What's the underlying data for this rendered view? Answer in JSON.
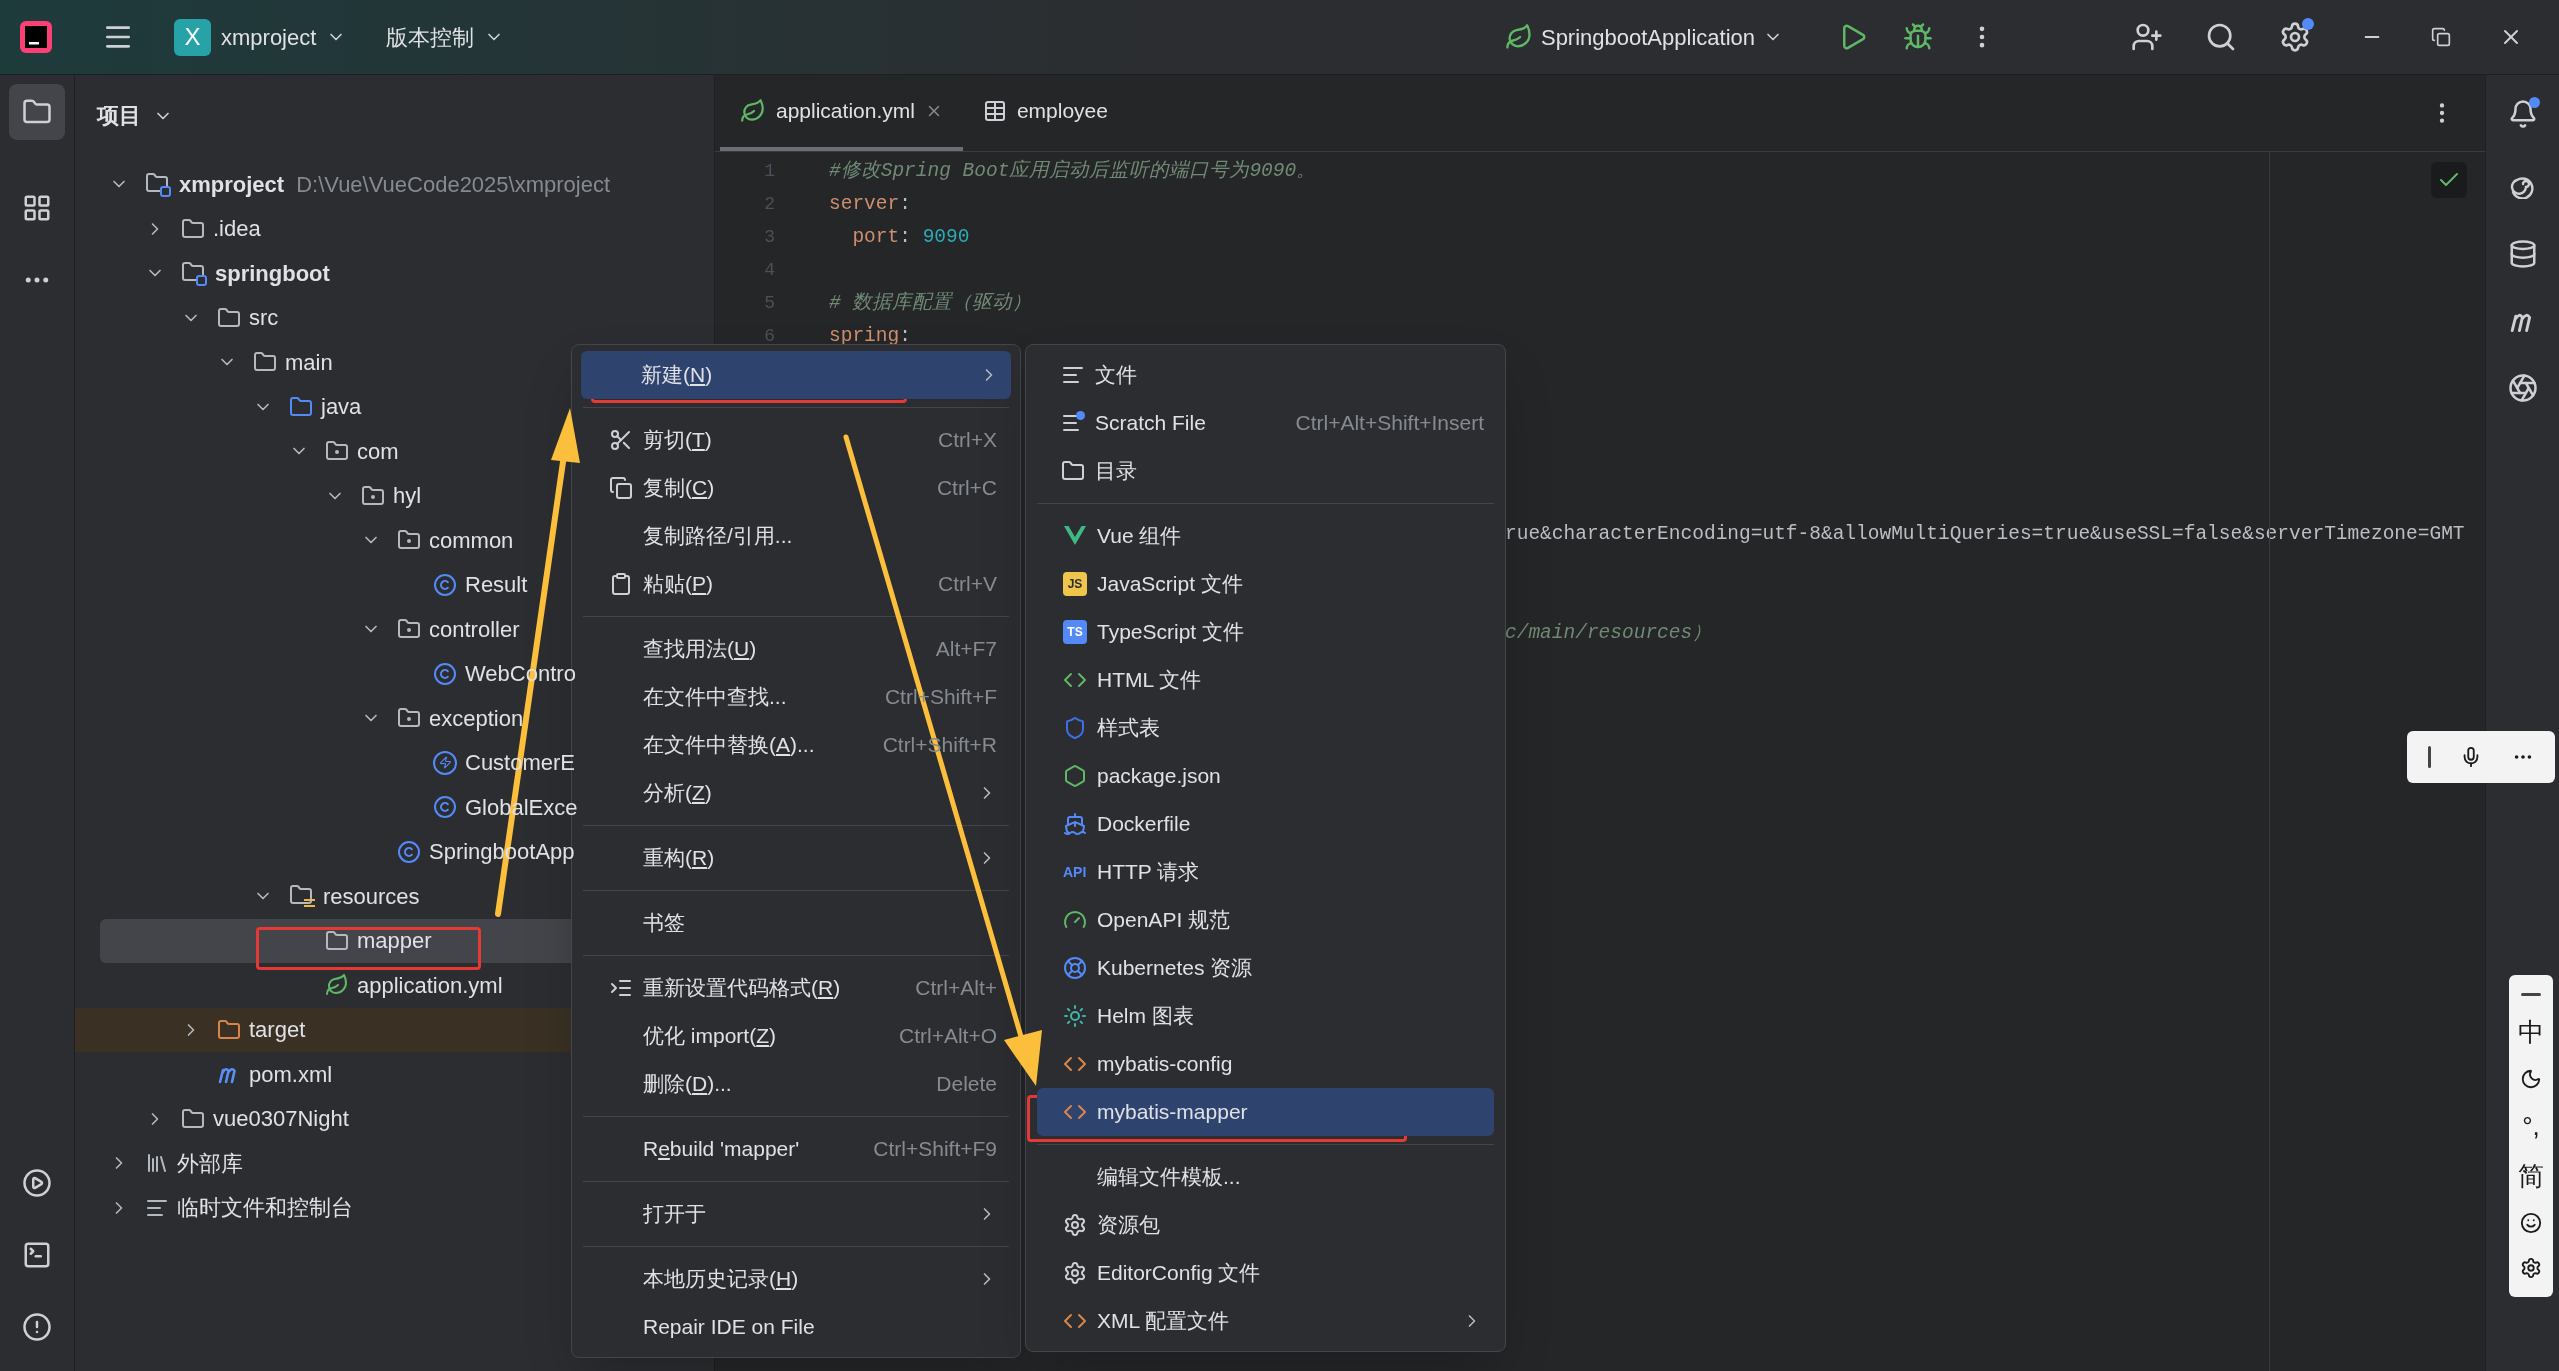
{
  "title_bar": {
    "project_badge": "X",
    "project": "xmproject",
    "vcs": "版本控制",
    "run_config": "SpringbootApplication",
    "settings_badge": true
  },
  "activity_bar": {
    "items": [
      {
        "kind": "project",
        "selected": true
      },
      {
        "kind": "structure",
        "selected": false
      },
      {
        "kind": "more",
        "selected": false
      }
    ],
    "bottom": [
      {
        "kind": "run"
      },
      {
        "kind": "terminal"
      },
      {
        "kind": "problems"
      }
    ]
  },
  "project_panel": {
    "title": "项目",
    "tree": [
      {
        "label": "xmproject",
        "kind": "module",
        "path": "D:\\Vue\\VueCode2025\\xmproject",
        "expanded": true,
        "selected": false,
        "children": [
          {
            "label": ".idea",
            "kind": "folder",
            "expanded": false,
            "selected": false
          },
          {
            "label": "springboot",
            "kind": "module",
            "expanded": true,
            "selected": false,
            "children": [
              {
                "label": "src",
                "kind": "folder",
                "expanded": true,
                "selected": false,
                "children": [
                  {
                    "label": "main",
                    "kind": "folder",
                    "expanded": true,
                    "selected": false,
                    "children": [
                      {
                        "label": "java",
                        "kind": "source",
                        "expanded": true,
                        "selected": false,
                        "children": [
                          {
                            "label": "com",
                            "kind": "package",
                            "expanded": true,
                            "selected": false,
                            "children": [
                              {
                                "label": "hyl",
                                "kind": "package",
                                "expanded": true,
                                "selected": false,
                                "children": [
                                  {
                                    "label": "common",
                                    "kind": "package",
                                    "expanded": true,
                                    "selected": false,
                                    "children": [
                                      {
                                        "label": "Result",
                                        "kind": "class",
                                        "selected": false
                                      }
                                    ]
                                  },
                                  {
                                    "label": "controller",
                                    "kind": "package",
                                    "expanded": true,
                                    "selected": false,
                                    "children": [
                                      {
                                        "label": "WebContro",
                                        "kind": "class",
                                        "selected": false
                                      }
                                    ]
                                  },
                                  {
                                    "label": "exception",
                                    "kind": "package",
                                    "expanded": true,
                                    "selected": false,
                                    "children": [
                                      {
                                        "label": "CustomerE",
                                        "kind": "exception",
                                        "selected": false
                                      },
                                      {
                                        "label": "GlobalExce",
                                        "kind": "class",
                                        "selected": false
                                      }
                                    ]
                                  },
                                  {
                                    "label": "SpringbootApp",
                                    "kind": "app",
                                    "selected": false
                                  }
                                ]
                              }
                            ]
                          }
                        ]
                      },
                      {
                        "label": "resources",
                        "kind": "resources",
                        "expanded": true,
                        "selected": false,
                        "children": [
                          {
                            "label": "mapper",
                            "kind": "folder",
                            "selected": true
                          },
                          {
                            "label": "application.yml",
                            "kind": "yaml",
                            "selected": false
                          }
                        ]
                      }
                    ]
                  }
                ]
              },
              {
                "label": "target",
                "kind": "excluded",
                "expanded": false,
                "selected": false
              },
              {
                "label": "pom.xml",
                "kind": "maven",
                "selected": false
              }
            ]
          },
          {
            "label": "vue0307Night",
            "kind": "folder",
            "expanded": false,
            "selected": false
          }
        ]
      },
      {
        "label": "外部库",
        "kind": "library",
        "expanded": false,
        "selected": false
      },
      {
        "label": "临时文件和控制台",
        "kind": "scratches",
        "expanded": false,
        "selected": false
      }
    ]
  },
  "editor": {
    "tabs": [
      {
        "label": "application.yml",
        "kind": "yaml",
        "selected": true,
        "closable": true
      },
      {
        "label": "employee",
        "kind": "table",
        "selected": false,
        "closable": false
      }
    ],
    "lines": [
      {
        "number": "1",
        "tokens": [
          {
            "text": "#修改Spring Boot应用启动后监听的端口号为9090。",
            "kind": "comment"
          }
        ]
      },
      {
        "number": "2",
        "tokens": [
          {
            "text": "server",
            "kind": "key"
          },
          {
            "text": ":",
            "kind": "plain"
          }
        ]
      },
      {
        "number": "3",
        "tokens": [
          {
            "text": "  port",
            "kind": "key"
          },
          {
            "text": ": ",
            "kind": "plain"
          },
          {
            "text": "9090",
            "kind": "number"
          }
        ]
      },
      {
        "number": "4"
      },
      {
        "number": "5",
        "tokens": [
          {
            "text": "# 数据库配置（驱动）",
            "kind": "comment"
          }
        ]
      },
      {
        "number": "6",
        "tokens": [
          {
            "text": "spring",
            "kind": "key"
          },
          {
            "text": ":",
            "kind": "plain"
          }
        ]
      }
    ],
    "clipped_lines": [
      {
        "text": "rue&characterEncoding=utf-8&allowMultiQueries=true&useSSL=false&serverTimezone=GMT",
        "kind": "plain"
      },
      {
        "text": "c/main/resources）",
        "kind": "comment"
      }
    ]
  },
  "context_menu": {
    "groups": [
      [
        {
          "label": [
            "新建(",
            "N",
            ")"
          ],
          "submenu": true,
          "selected": true
        }
      ],
      [
        {
          "label": [
            "剪切(",
            "T",
            ")"
          ],
          "kind": "cut",
          "shortcut": "Ctrl+X",
          "selected": false
        },
        {
          "label": [
            "复制(",
            "C",
            ")"
          ],
          "kind": "copy",
          "shortcut": "Ctrl+C",
          "selected": false
        },
        {
          "label": [
            "复制路径/引用..."
          ],
          "selected": false
        },
        {
          "label": [
            "粘贴(",
            "P",
            ")"
          ],
          "kind": "paste",
          "shortcut": "Ctrl+V",
          "selected": false
        }
      ],
      [
        {
          "label": [
            "查找用法(",
            "U",
            ")"
          ],
          "shortcut": "Alt+F7",
          "selected": false
        },
        {
          "label": [
            "在文件中查找..."
          ],
          "shortcut": "Ctrl+Shift+F",
          "selected": false
        },
        {
          "label": [
            "在文件中替换(",
            "A",
            ")..."
          ],
          "shortcut": "Ctrl+Shift+R",
          "selected": false
        },
        {
          "label": [
            "分析(",
            "Z",
            ")"
          ],
          "submenu": true,
          "selected": false
        }
      ],
      [
        {
          "label": [
            "重构(",
            "R",
            ")"
          ],
          "submenu": true,
          "selected": false
        }
      ],
      [
        {
          "label": [
            "书签"
          ],
          "selected": false
        }
      ],
      [
        {
          "label": [
            "重新设置代码格式(",
            "R",
            ")"
          ],
          "kind": "reformat",
          "shortcut": "Ctrl+Alt+",
          "selected": false
        },
        {
          "label": [
            "优化 import(",
            "Z",
            ")"
          ],
          "shortcut": "Ctrl+Alt+O",
          "selected": false
        },
        {
          "label": [
            "删除(",
            "D",
            ")..."
          ],
          "shortcut": "Delete",
          "selected": false
        }
      ],
      [
        {
          "label": [
            "R",
            "e",
            "build 'mapper'"
          ],
          "shortcut": "Ctrl+Shift+F9",
          "selected": false
        }
      ],
      [
        {
          "label": [
            "打开于"
          ],
          "submenu": true,
          "selected": false
        }
      ],
      [
        {
          "label": [
            "本地历史记录(",
            "H",
            ")"
          ],
          "submenu": true,
          "selected": false
        },
        {
          "label": [
            "Repair IDE on File"
          ],
          "selected": false
        }
      ]
    ]
  },
  "new_submenu": {
    "groups": [
      [
        {
          "label": "文件",
          "kind": "text",
          "selected": false
        },
        {
          "label": "Scratch File",
          "kind": "scratch",
          "shortcut": "Ctrl+Alt+Shift+Insert",
          "selected": false
        },
        {
          "label": "目录",
          "kind": "folder",
          "selected": false
        }
      ],
      [
        {
          "label": "Vue 组件",
          "kind": "vue",
          "selected": false
        },
        {
          "label": "JavaScript 文件",
          "kind": "js",
          "badge": "JS",
          "selected": false
        },
        {
          "label": "TypeScript 文件",
          "kind": "ts",
          "badge": "TS",
          "selected": false
        },
        {
          "label": "HTML 文件",
          "kind": "html",
          "selected": false
        },
        {
          "label": "样式表",
          "kind": "css",
          "selected": false
        },
        {
          "label": "package.json",
          "kind": "node",
          "selected": false
        },
        {
          "label": "Dockerfile",
          "kind": "docker",
          "selected": false
        },
        {
          "label": "HTTP 请求",
          "kind": "api",
          "badge": "API",
          "selected": false
        },
        {
          "label": "OpenAPI 规范",
          "kind": "openapi",
          "selected": false
        },
        {
          "label": "Kubernetes 资源",
          "kind": "kubernetes",
          "selected": false
        },
        {
          "label": "Helm 图表",
          "kind": "helm",
          "selected": false
        },
        {
          "label": "mybatis-config",
          "kind": "xml",
          "selected": false
        },
        {
          "label": "mybatis-mapper",
          "kind": "xml",
          "selected": true
        }
      ],
      [
        {
          "label": "编辑文件模板...",
          "selected": false
        },
        {
          "label": "资源包",
          "kind": "gear",
          "selected": false
        },
        {
          "label": "EditorConfig 文件",
          "kind": "gear",
          "selected": false
        },
        {
          "label": "XML 配置文件",
          "kind": "xml",
          "submenu": true,
          "selected": false
        }
      ]
    ]
  },
  "right_strip": {
    "items": [
      {
        "kind": "notifications",
        "badge": true
      },
      {
        "kind": "swirl"
      },
      {
        "kind": "database"
      },
      {
        "kind": "maven"
      },
      {
        "kind": "aperture"
      }
    ]
  },
  "ime_toolbar": {
    "items": [
      {
        "kind": "handle"
      },
      {
        "kind": "mic"
      },
      {
        "kind": "more"
      }
    ]
  },
  "ime_bar": {
    "items": [
      {
        "kind": "handle"
      },
      {
        "kind": "text",
        "text": "中"
      },
      {
        "kind": "moon"
      },
      {
        "kind": "text",
        "text": "°,"
      },
      {
        "kind": "text",
        "text": "简"
      },
      {
        "kind": "smile"
      },
      {
        "kind": "settings"
      }
    ]
  }
}
